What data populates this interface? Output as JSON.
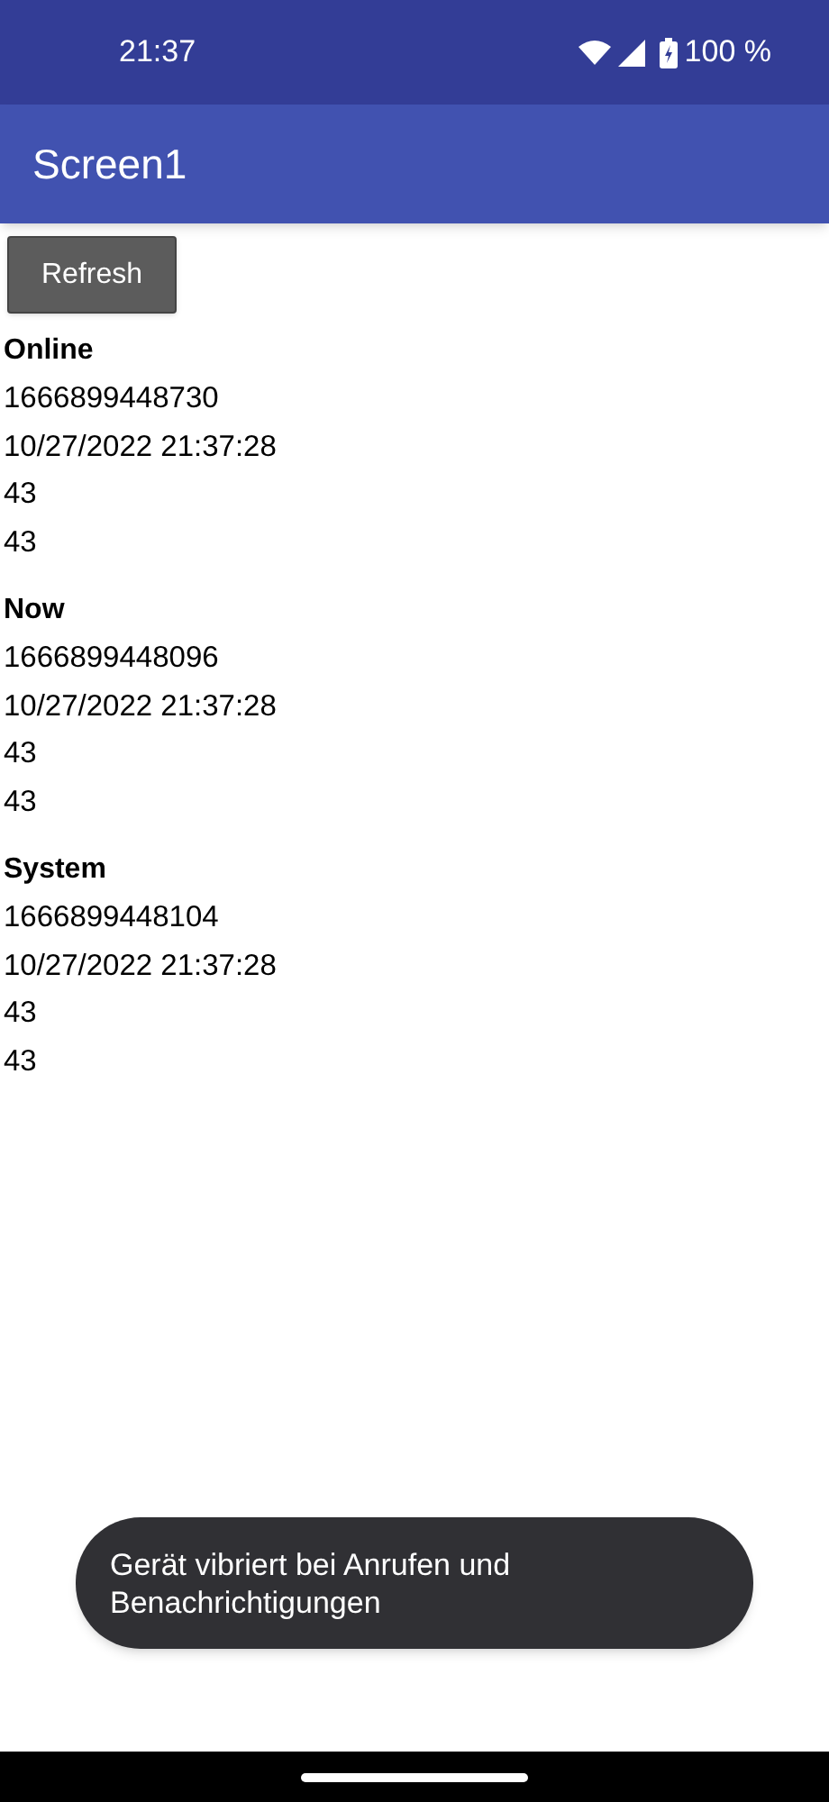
{
  "status_bar": {
    "time": "21:37",
    "battery": "100 %"
  },
  "app_bar": {
    "title": "Screen1"
  },
  "refresh_button": {
    "label": "Refresh"
  },
  "sections": [
    {
      "heading": "Online",
      "lines": [
        "1666899448730",
        "10/27/2022 21:37:28",
        "43",
        "43"
      ]
    },
    {
      "heading": "Now",
      "lines": [
        "1666899448096",
        "10/27/2022 21:37:28",
        "43",
        "43"
      ]
    },
    {
      "heading": "System",
      "lines": [
        "1666899448104",
        "10/27/2022 21:37:28",
        "43",
        "43"
      ]
    }
  ],
  "toast": {
    "message": "Gerät vibriert bei Anrufen und Benachrichtigungen"
  }
}
